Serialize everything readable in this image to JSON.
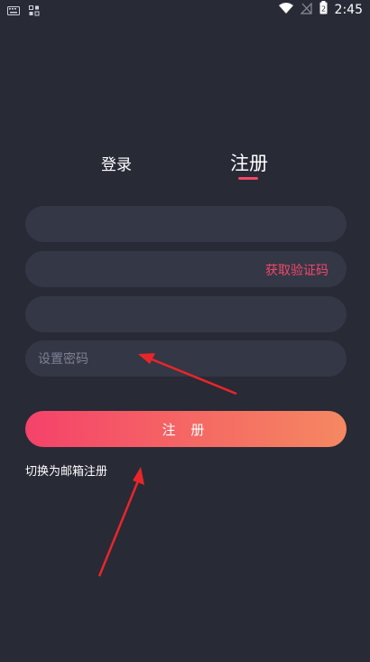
{
  "status_bar": {
    "time": "2:45",
    "battery_level": "2",
    "icons": [
      "keyboard-icon",
      "notification-icon",
      "wifi-icon",
      "no-signal-icon",
      "battery-icon"
    ]
  },
  "tabs": {
    "login": "登录",
    "register": "注册",
    "active": "register"
  },
  "form": {
    "field1": {
      "value": "",
      "placeholder": ""
    },
    "field2": {
      "value": "",
      "placeholder": "",
      "get_code_label": "获取验证码"
    },
    "field3": {
      "value": "",
      "placeholder": ""
    },
    "password": {
      "value": "",
      "placeholder": "设置密码"
    }
  },
  "submit_label": "注 册",
  "switch_email_label": "切换为邮箱注册",
  "colors": {
    "background": "#282a36",
    "field_bg": "#343746",
    "accent": "#f24768",
    "button_gradient_start": "#f5426a",
    "button_gradient_end": "#f58862",
    "annotation_arrow": "#e8262a"
  }
}
